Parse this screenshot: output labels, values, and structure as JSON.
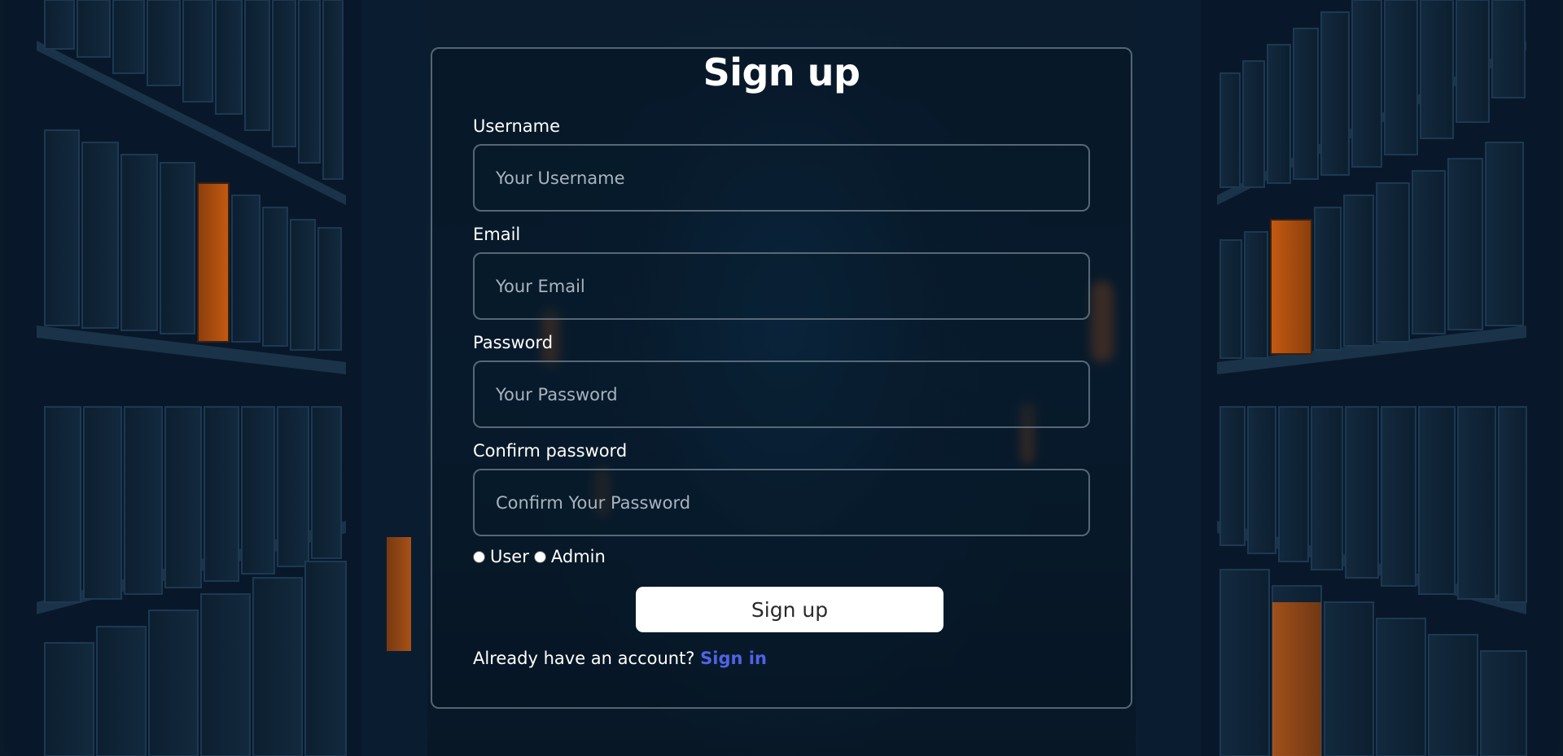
{
  "form": {
    "title": "Sign up",
    "username": {
      "label": "Username",
      "placeholder": "Your Username"
    },
    "email": {
      "label": "Email",
      "placeholder": "Your Email"
    },
    "password": {
      "label": "Password",
      "placeholder": "Your Password"
    },
    "confirm": {
      "label": "Confirm password",
      "placeholder": "Confirm Your Password"
    },
    "roles": {
      "user": "User",
      "admin": "Admin"
    },
    "submit_label": "Sign up",
    "footer_text": "Already have an account?",
    "footer_link": "Sign in"
  },
  "colors": {
    "background": "#0b1a2a",
    "link": "#4f63e6",
    "button_bg": "#ffffff",
    "book_glow": "#ff7a1a"
  }
}
